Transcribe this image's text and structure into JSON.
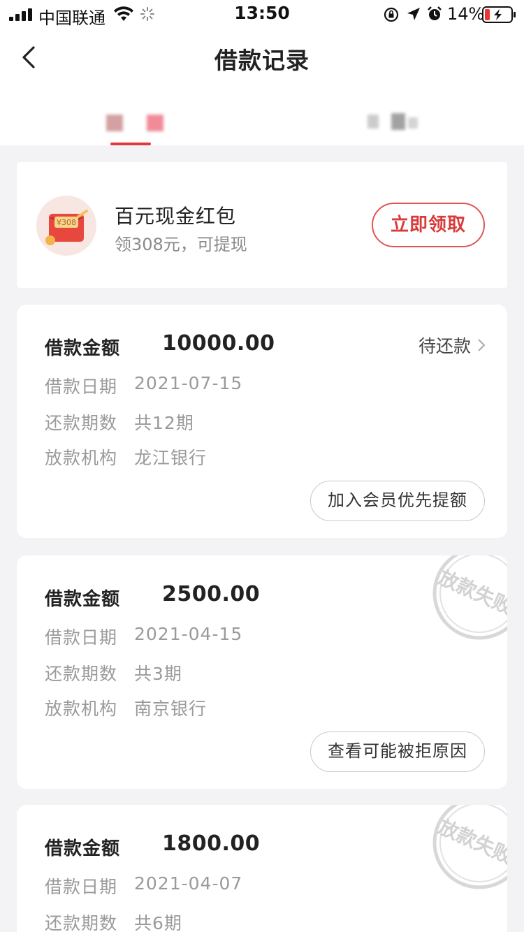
{
  "status_bar": {
    "carrier": "中国联通",
    "time": "13:50",
    "battery_percent": "14%",
    "icons": [
      "signal-icon",
      "wifi-icon",
      "loading-icon",
      "rotation-lock-icon",
      "location-icon",
      "alarm-icon",
      "battery-icon"
    ]
  },
  "nav": {
    "title": "借款记录",
    "back_icon": "chevron-left-icon"
  },
  "tabs": [
    {
      "label": "",
      "active": true
    },
    {
      "label": "",
      "active": false
    }
  ],
  "promo": {
    "title": "百元现金红包",
    "subtitle": "领308元，可提现",
    "button_label": "立即领取",
    "icon_text": "¥308"
  },
  "loans": [
    {
      "amount_label": "借款金额",
      "amount": "10000.00",
      "date_label": "借款日期",
      "date": "2021-07-15",
      "periods_label": "还款期数",
      "periods": "共12期",
      "institution_label": "放款机构",
      "institution": "龙江银行",
      "status": "待还款",
      "action_label": "加入会员优先提额"
    },
    {
      "amount_label": "借款金额",
      "amount": "2500.00",
      "date_label": "借款日期",
      "date": "2021-04-15",
      "periods_label": "还款期数",
      "periods": "共3期",
      "institution_label": "放款机构",
      "institution": "南京银行",
      "stamp_text": "放款失败",
      "action_label": "查看可能被拒原因"
    },
    {
      "amount_label": "借款金额",
      "amount": "1800.00",
      "date_label": "借款日期",
      "date": "2021-04-07",
      "periods_label": "还款期数",
      "periods": "共6期",
      "stamp_text": "放款失败"
    }
  ],
  "colors": {
    "accent_red": "#e23a3a",
    "background": "#f3f3f6",
    "muted_text": "#9a9a9a"
  }
}
